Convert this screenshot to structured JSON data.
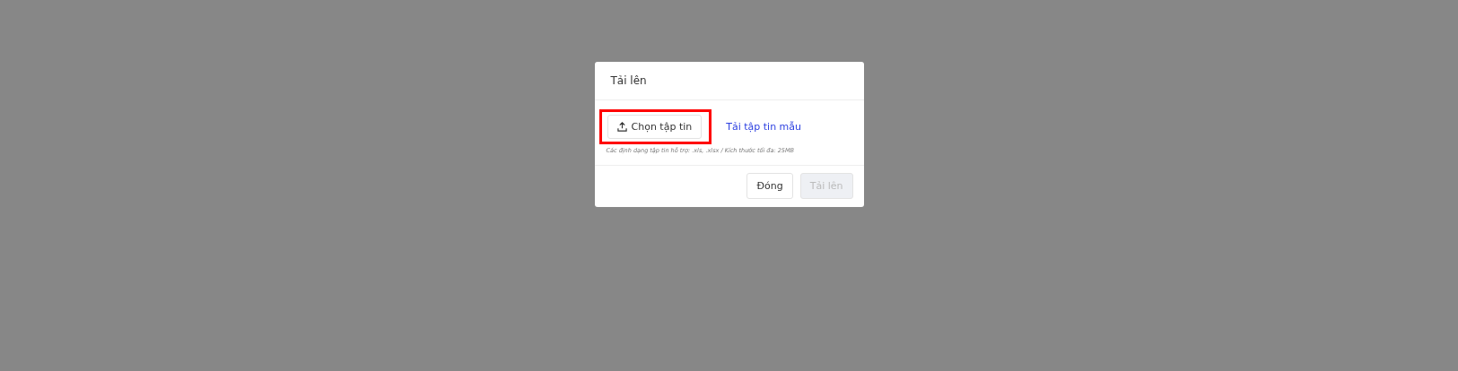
{
  "dialog": {
    "title": "Tải lên",
    "choose_button": {
      "label": "Chọn tập tin",
      "highlighted": true
    },
    "template_link": "Tải tập tin mẫu",
    "hint": "Các định dạng tập tin hỗ trợ: .xls, .xlsx / Kích thước tối đa: 25MB",
    "buttons": [
      {
        "label": "Đóng",
        "disabled": false
      },
      {
        "label": "Tải lên",
        "disabled": true
      }
    ]
  }
}
